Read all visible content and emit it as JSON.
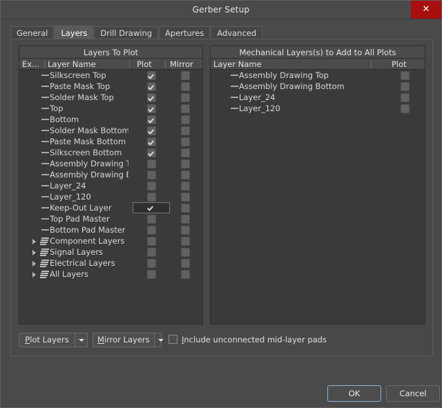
{
  "window": {
    "title": "Gerber Setup",
    "close_icon": "close-icon"
  },
  "tabs": [
    {
      "label": "General",
      "active": false
    },
    {
      "label": "Layers",
      "active": true
    },
    {
      "label": "Drill Drawing",
      "active": false
    },
    {
      "label": "Apertures",
      "active": false
    },
    {
      "label": "Advanced",
      "active": false
    }
  ],
  "left_panel": {
    "title": "Layers To Plot",
    "columns": [
      "Ex...",
      "Layer Name",
      "Plot",
      "Mirror"
    ],
    "rows": [
      {
        "name": "Silkscreen Top",
        "icon": "layer-icon",
        "plot": true,
        "mirror": false,
        "expandable": false,
        "focused": false
      },
      {
        "name": "Paste Mask Top",
        "icon": "layer-icon",
        "plot": true,
        "mirror": false,
        "expandable": false,
        "focused": false
      },
      {
        "name": "Solder Mask Top",
        "icon": "layer-icon",
        "plot": true,
        "mirror": false,
        "expandable": false,
        "focused": false
      },
      {
        "name": "Top",
        "icon": "layer-icon",
        "plot": true,
        "mirror": false,
        "expandable": false,
        "focused": false
      },
      {
        "name": "Bottom",
        "icon": "layer-icon",
        "plot": true,
        "mirror": false,
        "expandable": false,
        "focused": false
      },
      {
        "name": "Solder Mask Bottom",
        "icon": "layer-icon",
        "plot": true,
        "mirror": false,
        "expandable": false,
        "focused": false
      },
      {
        "name": "Paste Mask Bottom",
        "icon": "layer-icon",
        "plot": true,
        "mirror": false,
        "expandable": false,
        "focused": false
      },
      {
        "name": "Silkscreen Bottom",
        "icon": "layer-icon",
        "plot": true,
        "mirror": false,
        "expandable": false,
        "focused": false
      },
      {
        "name": "Assembly Drawing Top",
        "icon": "layer-icon",
        "plot": false,
        "mirror": false,
        "expandable": false,
        "focused": false
      },
      {
        "name": "Assembly Drawing Bottom",
        "icon": "layer-icon",
        "plot": false,
        "mirror": false,
        "expandable": false,
        "focused": false
      },
      {
        "name": "Layer_24",
        "icon": "layer-icon",
        "plot": false,
        "mirror": false,
        "expandable": false,
        "focused": false
      },
      {
        "name": "Layer_120",
        "icon": "layer-icon",
        "plot": false,
        "mirror": false,
        "expandable": false,
        "focused": false
      },
      {
        "name": "Keep-Out Layer",
        "icon": "layer-icon",
        "plot": true,
        "mirror": false,
        "expandable": false,
        "focused": true
      },
      {
        "name": "Top Pad Master",
        "icon": "layer-icon",
        "plot": false,
        "mirror": false,
        "expandable": false,
        "focused": false
      },
      {
        "name": "Bottom Pad Master",
        "icon": "layer-icon",
        "plot": false,
        "mirror": false,
        "expandable": false,
        "focused": false
      },
      {
        "name": "Component Layers",
        "icon": "layer-group-icon",
        "plot": false,
        "mirror": false,
        "expandable": true,
        "focused": false
      },
      {
        "name": "Signal Layers",
        "icon": "layer-group-icon",
        "plot": false,
        "mirror": false,
        "expandable": true,
        "focused": false
      },
      {
        "name": "Electrical Layers",
        "icon": "layer-group-icon",
        "plot": false,
        "mirror": false,
        "expandable": true,
        "focused": false
      },
      {
        "name": "All Layers",
        "icon": "layer-group-icon",
        "plot": false,
        "mirror": false,
        "expandable": true,
        "focused": false
      }
    ]
  },
  "right_panel": {
    "title": "Mechanical Layers(s) to Add to All Plots",
    "columns": [
      "Layer Name",
      "Plot"
    ],
    "rows": [
      {
        "name": "Assembly Drawing Top",
        "icon": "layer-icon",
        "plot": false
      },
      {
        "name": "Assembly Drawing Bottom",
        "icon": "layer-icon",
        "plot": false
      },
      {
        "name": "Layer_24",
        "icon": "layer-icon",
        "plot": false
      },
      {
        "name": "Layer_120",
        "icon": "layer-icon",
        "plot": false
      }
    ]
  },
  "footer": {
    "plot_layers_button": {
      "mnemonic": "P",
      "rest": "lot Layers"
    },
    "mirror_layers_button": {
      "mnemonic": "M",
      "rest": "irror Layers"
    },
    "include_pads": {
      "mnemonic": "I",
      "rest": "nclude unconnected mid-layer pads",
      "checked": false
    }
  },
  "dialog_buttons": {
    "ok": "OK",
    "cancel": "Cancel"
  }
}
